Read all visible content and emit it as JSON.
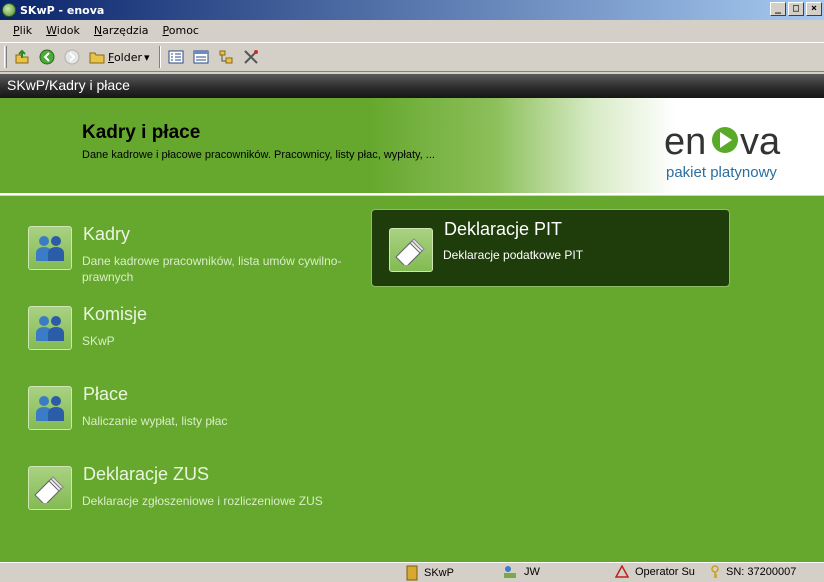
{
  "window": {
    "title": "SKwP - enova",
    "buttons": {
      "minimize": "_",
      "maximize": "□",
      "close": "×"
    }
  },
  "menu": [
    "Plik",
    "Widok",
    "Narzędzia",
    "Pomoc"
  ],
  "toolbar": {
    "folder_label": "Folder",
    "folder_arrow": "▾"
  },
  "breadcrumb": "SKwP/Kadry i płace",
  "header": {
    "title": "Kadry i płace",
    "subtitle": "Dane kadrowe i płacowe pracowników. Pracownicy, listy płac, wypłaty, ...",
    "logo_text": "enova",
    "logo_subtext": "pakiet platynowy"
  },
  "modules": [
    {
      "title": "Kadry",
      "description": "Dane kadrowe pracowników, lista umów cywilno-prawnych",
      "icon": "people-icon"
    },
    {
      "title": "Komisje",
      "description": "SKwP",
      "icon": "people-icon"
    },
    {
      "title": "Płace",
      "description": "Naliczanie wypłat, listy płac",
      "icon": "people-icon"
    },
    {
      "title": "Deklaracje ZUS",
      "description": "Deklaracje zgłoszeniowe i rozliczeniowe ZUS",
      "icon": "documents-icon"
    },
    {
      "title": "Deklaracje PIT",
      "description": "Deklaracje podatkowe PIT",
      "icon": "documents-icon",
      "selected": true
    }
  ],
  "statusbar": {
    "database": "SKwP",
    "user": "JW",
    "operator": "Operator Su",
    "serial": "SN: 37200007"
  },
  "colors": {
    "main_green": "#66a82e",
    "selected_bg": "#1f3d0b",
    "title_bar": "#0a246a",
    "logo_blue": "#2a6fa0"
  }
}
